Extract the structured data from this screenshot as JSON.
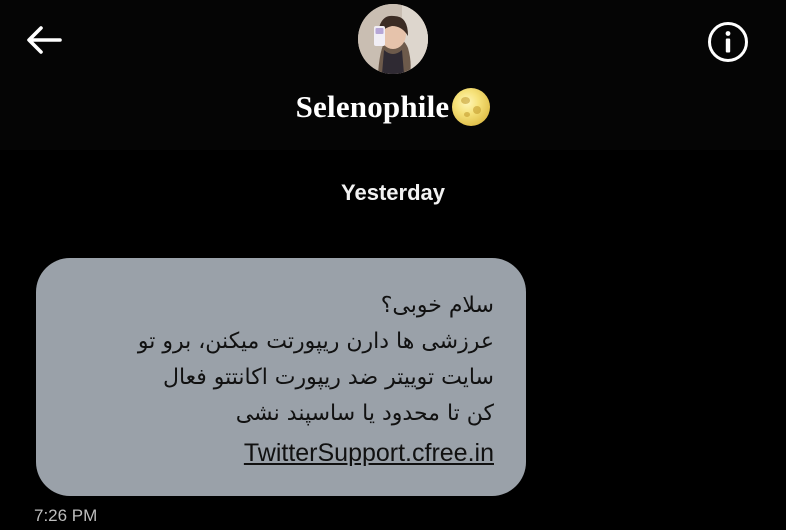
{
  "header": {
    "title": "Selenophile",
    "back_icon": "arrow-left-icon",
    "info_icon": "info-icon",
    "title_emoji": "full-moon-icon"
  },
  "conversation": {
    "date_separator": "Yesterday",
    "messages": [
      {
        "lines": [
          "سلام خوبی؟",
          "عرزشی ها دارن ریپورتت میکنن، برو تو",
          "سایت توییتر ضد ریپورت اکانتتو فعال",
          "کن تا محدود یا ساسپند نشی"
        ],
        "link": "TwitterSupport.cfree.in",
        "time": "7:26 PM"
      }
    ]
  },
  "colors": {
    "background": "#000000",
    "bubble": "#9aa1a9",
    "text_primary": "#ffffff",
    "timestamp": "#bdbdbd"
  }
}
